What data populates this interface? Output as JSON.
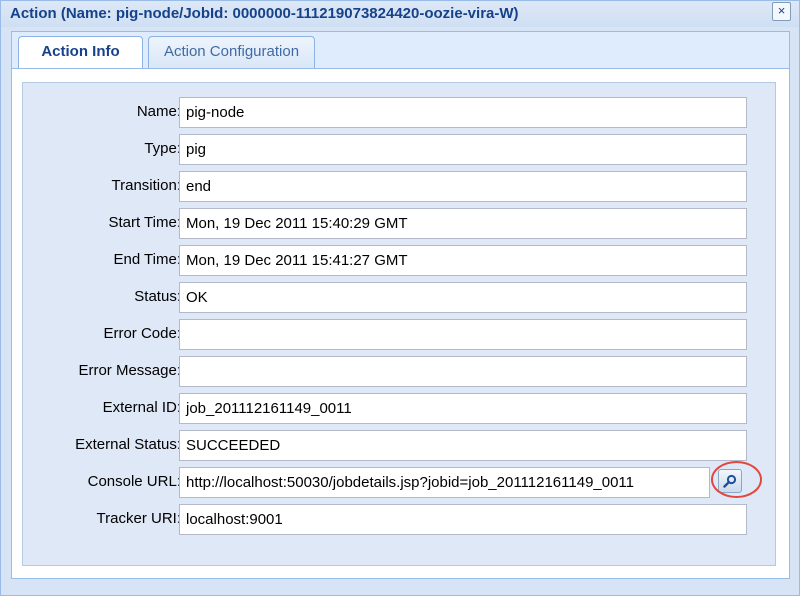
{
  "window": {
    "title": "Action (Name: pig-node/JobId: 0000000-111219073824420-oozie-vira-W)",
    "close_glyph": "×"
  },
  "tabs": [
    {
      "label": "Action Info",
      "active": true
    },
    {
      "label": "Action Configuration",
      "active": false
    }
  ],
  "fields": {
    "name": {
      "label": "Name:",
      "value": "pig-node"
    },
    "type": {
      "label": "Type:",
      "value": "pig"
    },
    "transition": {
      "label": "Transition:",
      "value": "end"
    },
    "start_time": {
      "label": "Start Time:",
      "value": "Mon, 19 Dec 2011 15:40:29 GMT"
    },
    "end_time": {
      "label": "End Time:",
      "value": "Mon, 19 Dec 2011 15:41:27 GMT"
    },
    "status": {
      "label": "Status:",
      "value": "OK"
    },
    "error_code": {
      "label": "Error Code:",
      "value": ""
    },
    "error_message": {
      "label": "Error Message:",
      "value": ""
    },
    "external_id": {
      "label": "External ID:",
      "value": "job_201112161149_0011"
    },
    "external_status": {
      "label": "External Status:",
      "value": "SUCCEEDED"
    },
    "console_url": {
      "label": "Console URL:",
      "value": "http://localhost:50030/jobdetails.jsp?jobid=job_201112161149_0011"
    },
    "tracker_uri": {
      "label": "Tracker URI:",
      "value": "localhost:9001"
    }
  },
  "icons": {
    "close": "close-icon",
    "lookup": "magnifier-icon"
  },
  "colors": {
    "title_text": "#15428b",
    "highlight_ring": "#e0473f",
    "panel_bg": "#dfe8f6"
  }
}
